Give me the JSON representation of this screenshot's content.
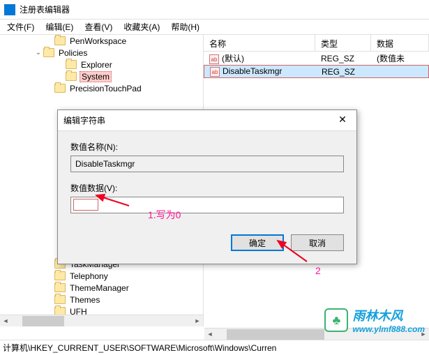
{
  "window": {
    "title": "注册表编辑器"
  },
  "menu": {
    "file": "文件(F)",
    "edit": "编辑(E)",
    "view": "查看(V)",
    "favorites": "收藏夹(A)",
    "help": "帮助(H)"
  },
  "tree": {
    "items": [
      {
        "indent": 4,
        "toggle": "",
        "label": "PenWorkspace"
      },
      {
        "indent": 3,
        "toggle": "⌄",
        "label": "Policies"
      },
      {
        "indent": 5,
        "toggle": "",
        "label": "Explorer"
      },
      {
        "indent": 5,
        "toggle": "",
        "label": "System",
        "selected": true
      },
      {
        "indent": 4,
        "toggle": "",
        "label": "PrecisionTouchPad"
      },
      {
        "indent": 4,
        "toggle": "",
        "label": "TaskManager"
      },
      {
        "indent": 4,
        "toggle": "",
        "label": "Telephony"
      },
      {
        "indent": 4,
        "toggle": "",
        "label": "ThemeManager"
      },
      {
        "indent": 4,
        "toggle": "",
        "label": "Themes"
      },
      {
        "indent": 4,
        "toggle": "",
        "label": "UFH"
      }
    ]
  },
  "list": {
    "headers": {
      "name": "名称",
      "type": "类型",
      "data": "数据"
    },
    "rows": [
      {
        "icon": "ab",
        "name": "(默认)",
        "type": "REG_SZ",
        "data": "(数值未"
      },
      {
        "icon": "ab",
        "name": "DisableTaskmgr",
        "type": "REG_SZ",
        "data": "",
        "highlighted": true,
        "selected": true
      }
    ]
  },
  "dialog": {
    "title": "编辑字符串",
    "name_label": "数值名称(N):",
    "name_value": "DisableTaskmgr",
    "data_label": "数值数据(V):",
    "data_value": "",
    "ok": "确定",
    "cancel": "取消"
  },
  "annotations": {
    "a1": "1.写为0",
    "a2": "2"
  },
  "statusbar": {
    "path": "计算机\\HKEY_CURRENT_USER\\SOFTWARE\\Microsoft\\Windows\\Curren"
  },
  "watermark": {
    "cn": "雨林木风",
    "url": "www.ylmf888.com"
  }
}
